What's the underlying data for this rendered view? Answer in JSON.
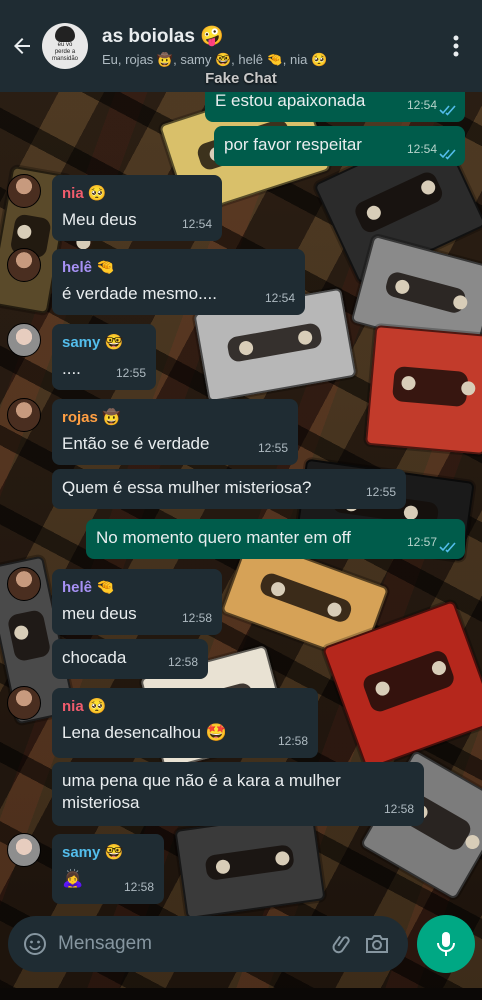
{
  "header": {
    "title": "as boiolas 🤪",
    "members": "Eu, rojas 🤠, samy 🤓, helê 🤏, nia 🥺",
    "avatar_caption": "eu vo\nperde a\nmansidão"
  },
  "watermark": "Fake Chat",
  "messages": [
    {
      "dir": "out",
      "text": "E estou apaixonada",
      "time": "12:54",
      "read": true
    },
    {
      "dir": "out",
      "text": "por favor respeitar",
      "time": "12:54",
      "read": true
    },
    {
      "dir": "in",
      "sender": "nia 🥺",
      "sender_color": "#f15c6d",
      "text": "Meu deus",
      "time": "12:54"
    },
    {
      "dir": "in",
      "sender": "helê 🤏",
      "sender_color": "#a791f4",
      "text": "é verdade mesmo....",
      "time": "12:54"
    },
    {
      "dir": "in",
      "sender": "samy 🤓",
      "sender_color": "#53bdeb",
      "text": "....",
      "time": "12:55"
    },
    {
      "dir": "in",
      "sender": "rojas 🤠",
      "sender_color": "#ff9f43",
      "text": "Então se é verdade",
      "time": "12:55"
    },
    {
      "dir": "in",
      "text": "Quem é essa mulher misteriosa?",
      "time": "12:55"
    },
    {
      "dir": "out",
      "text": "No momento quero manter em off",
      "time": "12:57",
      "read": true
    },
    {
      "dir": "in",
      "sender": "helê 🤏",
      "sender_color": "#a791f4",
      "text": "meu deus",
      "time": "12:58"
    },
    {
      "dir": "in",
      "text": "chocada",
      "time": "12:58"
    },
    {
      "dir": "in",
      "sender": "nia 🥺",
      "sender_color": "#f15c6d",
      "text": "Lena desencalhou 🤩",
      "time": "12:58"
    },
    {
      "dir": "in",
      "text": "uma pena que não é a kara a mulher misteriosa",
      "time": "12:58"
    },
    {
      "dir": "in",
      "sender": "samy 🤓",
      "sender_color": "#53bdeb",
      "text": "🙇‍♀️",
      "time": "12:58"
    }
  ],
  "composer": {
    "placeholder": "Mensagem"
  },
  "icons": {
    "back": "arrow-left-icon",
    "menu": "more-vertical-icon",
    "emoji": "emoji-icon",
    "attach": "paperclip-icon",
    "camera": "camera-icon",
    "mic": "microphone-icon",
    "read": "double-check-icon"
  },
  "colors": {
    "header_bg": "#1f2c33",
    "bubble_in": "#1f2c33",
    "bubble_out": "#005c4b",
    "accent": "#00a884",
    "read_tick": "#53bdeb"
  }
}
